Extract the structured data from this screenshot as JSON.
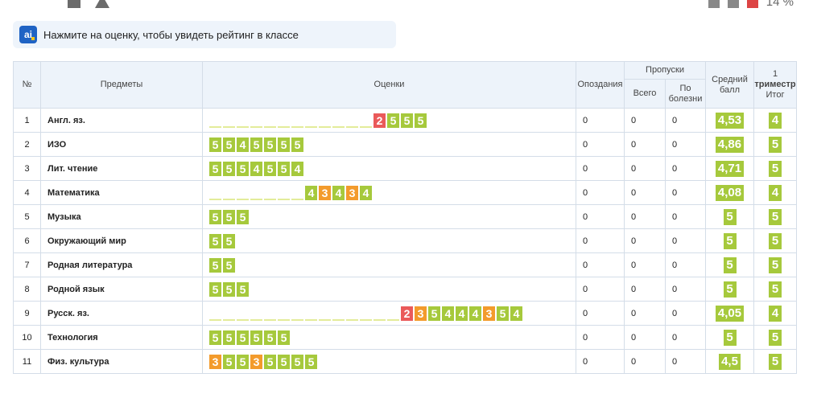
{
  "statusbar": {
    "battery": "14 %"
  },
  "notice": {
    "logo": "ai",
    "text": "Нажмите на оценку, чтобы увидеть рейтинг в классе"
  },
  "table": {
    "headers": {
      "num": "№",
      "subject": "Предметы",
      "grades": "Оценки",
      "late": "Опоздания",
      "absences": "Пропуски",
      "absences_total": "Всего",
      "absences_sick": "По болезни",
      "average": "Средний балл",
      "term_1": "1",
      "term_trimester": "триместр",
      "term_total": "Итог"
    },
    "rows": [
      {
        "num": "1",
        "subject": "Англ. яз.",
        "marks": [
          null,
          null,
          null,
          null,
          null,
          null,
          null,
          null,
          null,
          null,
          null,
          null,
          "2",
          "5",
          "5",
          "5"
        ],
        "late": "0",
        "total": "0",
        "sick": "0",
        "avg": "4,53",
        "final": "4"
      },
      {
        "num": "2",
        "subject": "ИЗО",
        "marks": [
          "5",
          "5",
          "4",
          "5",
          "5",
          "5",
          "5"
        ],
        "late": "0",
        "total": "0",
        "sick": "0",
        "avg": "4,86",
        "final": "5"
      },
      {
        "num": "3",
        "subject": "Лит. чтение",
        "marks": [
          "5",
          "5",
          "5",
          "4",
          "5",
          "5",
          "4"
        ],
        "late": "0",
        "total": "0",
        "sick": "0",
        "avg": "4,71",
        "final": "5"
      },
      {
        "num": "4",
        "subject": "Математика",
        "marks": [
          null,
          null,
          null,
          null,
          null,
          null,
          null,
          "4",
          "3",
          "4",
          "3",
          "4"
        ],
        "late": "0",
        "total": "0",
        "sick": "0",
        "avg": "4,08",
        "final": "4"
      },
      {
        "num": "5",
        "subject": "Музыка",
        "marks": [
          "5",
          "5",
          "5"
        ],
        "late": "0",
        "total": "0",
        "sick": "0",
        "avg": "5",
        "final": "5"
      },
      {
        "num": "6",
        "subject": "Окружающий мир",
        "marks": [
          "5",
          "5"
        ],
        "late": "0",
        "total": "0",
        "sick": "0",
        "avg": "5",
        "final": "5"
      },
      {
        "num": "7",
        "subject": "Родная литература",
        "marks": [
          "5",
          "5"
        ],
        "late": "0",
        "total": "0",
        "sick": "0",
        "avg": "5",
        "final": "5"
      },
      {
        "num": "8",
        "subject": "Родной язык",
        "marks": [
          "5",
          "5",
          "5"
        ],
        "late": "0",
        "total": "0",
        "sick": "0",
        "avg": "5",
        "final": "5"
      },
      {
        "num": "9",
        "subject": "Русск. яз.",
        "marks": [
          null,
          null,
          null,
          null,
          null,
          null,
          null,
          null,
          null,
          null,
          null,
          null,
          null,
          null,
          "2",
          "3",
          "5",
          "4",
          "4",
          "4",
          "3",
          "5",
          "4"
        ],
        "late": "0",
        "total": "0",
        "sick": "0",
        "avg": "4,05",
        "final": "4"
      },
      {
        "num": "10",
        "subject": "Технология",
        "marks": [
          "5",
          "5",
          "5",
          "5",
          "5",
          "5"
        ],
        "late": "0",
        "total": "0",
        "sick": "0",
        "avg": "5",
        "final": "5"
      },
      {
        "num": "11",
        "subject": "Физ. культура",
        "marks": [
          "3",
          "5",
          "5",
          "3",
          "5",
          "5",
          "5",
          "5"
        ],
        "late": "0",
        "total": "0",
        "sick": "0",
        "avg": "4,5",
        "final": "5"
      }
    ]
  },
  "colors": {
    "grade_good": "#a6c93c",
    "grade_three": "#f39b2c",
    "grade_two": "#ea5a5a",
    "link": "#1f86c8",
    "header_bg": "#edf3fa"
  }
}
